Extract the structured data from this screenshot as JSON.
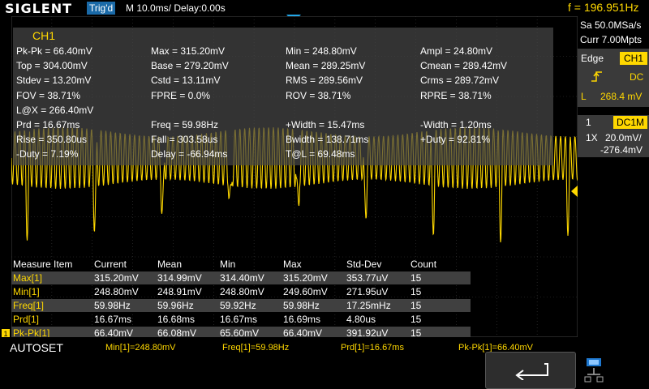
{
  "brand": "SIGLENT",
  "trigger_state": "Trig'd",
  "timebase": "M 10.0ms/ Delay:0.00s",
  "frequency_readout": "f = 196.951Hz",
  "channel_color": "#ffd800",
  "measure_panel": {
    "title": "CH1",
    "rows": [
      [
        "Pk-Pk = 66.40mV",
        "Max = 315.20mV",
        "Min = 248.80mV",
        "Ampl = 24.80mV"
      ],
      [
        "Top = 304.00mV",
        "Base = 279.20mV",
        "Mean = 289.25mV",
        "Cmean = 289.42mV"
      ],
      [
        "Stdev = 13.20mV",
        "Cstd = 13.11mV",
        "RMS = 289.56mV",
        "Crms = 289.72mV"
      ],
      [
        "FOV = 38.71%",
        "FPRE = 0.0%",
        "ROV = 38.71%",
        "RPRE = 38.71%"
      ],
      [
        "L@X = 266.40mV",
        "",
        "",
        ""
      ],
      [
        "Prd = 16.67ms",
        "Freq = 59.98Hz",
        "+Width = 15.47ms",
        "-Width = 1.20ms"
      ],
      [
        "Rise = 350.80us",
        "Fall = 303.58us",
        "Bwidth = 138.71ms",
        "+Duty = 92.81%"
      ],
      [
        "-Duty = 7.19%",
        "Delay = -66.94ms",
        "T@L = 69.48ms",
        ""
      ]
    ]
  },
  "statistics": {
    "headers": [
      "Measure Item",
      "Current",
      "Mean",
      "Min",
      "Max",
      "Std-Dev",
      "Count"
    ],
    "rows": [
      [
        "Max[1]",
        "315.20mV",
        "314.99mV",
        "314.40mV",
        "315.20mV",
        "353.77uV",
        "15"
      ],
      [
        "Min[1]",
        "248.80mV",
        "248.91mV",
        "248.80mV",
        "249.60mV",
        "271.95uV",
        "15"
      ],
      [
        "Freq[1]",
        "59.98Hz",
        "59.96Hz",
        "59.92Hz",
        "59.98Hz",
        "17.25mHz",
        "15"
      ],
      [
        "Prd[1]",
        "16.67ms",
        "16.68ms",
        "16.67ms",
        "16.69ms",
        "4.80us",
        "15"
      ],
      [
        "Pk-Pk[1]",
        "66.40mV",
        "66.08mV",
        "65.60mV",
        "66.40mV",
        "391.92uV",
        "15"
      ]
    ]
  },
  "right_panel": {
    "sample_rate": "Sa 50.0MSa/s",
    "memory_depth": "Curr 7.00Mpts",
    "trigger_type": "Edge",
    "trigger_source": "CH1",
    "trigger_slope_icon": "rising-edge-icon",
    "trigger_coupling": "DC",
    "trigger_level_label": "L",
    "trigger_level": "268.4 mV",
    "channel_number": "1",
    "channel_coupling": "DC1M",
    "probe": "1X",
    "volts_per_div": "20.0mV/",
    "offset": "-276.4mV"
  },
  "bottom_bar": {
    "autoset": "AUTOSET",
    "measurements": [
      "Min[1]=248.80mV",
      "Freq[1]=59.98Hz",
      "Prd[1]=16.67ms",
      "Pk-Pk[1]=66.40mV"
    ],
    "back_icon": "return-arrow-icon",
    "network_icon": "network-icon"
  },
  "channel_marker": "1"
}
